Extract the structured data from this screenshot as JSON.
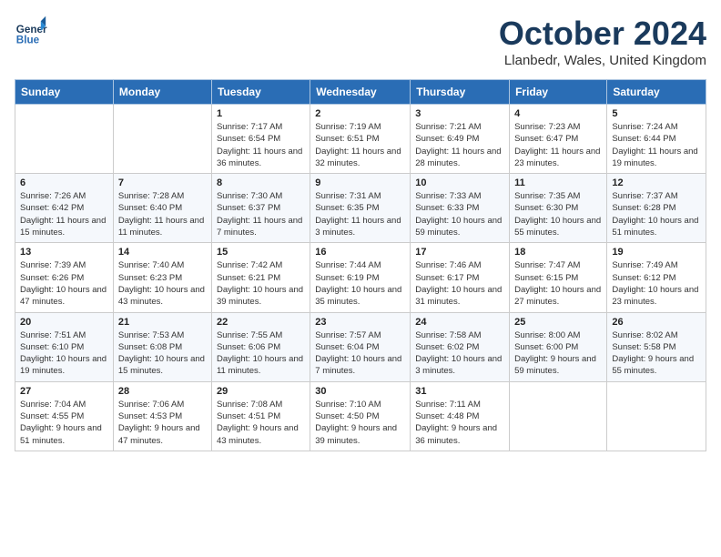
{
  "header": {
    "logo_line1": "General",
    "logo_line2": "Blue",
    "month": "October 2024",
    "location": "Llanbedr, Wales, United Kingdom"
  },
  "days_of_week": [
    "Sunday",
    "Monday",
    "Tuesday",
    "Wednesday",
    "Thursday",
    "Friday",
    "Saturday"
  ],
  "weeks": [
    [
      {
        "day": "",
        "info": ""
      },
      {
        "day": "",
        "info": ""
      },
      {
        "day": "1",
        "info": "Sunrise: 7:17 AM\nSunset: 6:54 PM\nDaylight: 11 hours and 36 minutes."
      },
      {
        "day": "2",
        "info": "Sunrise: 7:19 AM\nSunset: 6:51 PM\nDaylight: 11 hours and 32 minutes."
      },
      {
        "day": "3",
        "info": "Sunrise: 7:21 AM\nSunset: 6:49 PM\nDaylight: 11 hours and 28 minutes."
      },
      {
        "day": "4",
        "info": "Sunrise: 7:23 AM\nSunset: 6:47 PM\nDaylight: 11 hours and 23 minutes."
      },
      {
        "day": "5",
        "info": "Sunrise: 7:24 AM\nSunset: 6:44 PM\nDaylight: 11 hours and 19 minutes."
      }
    ],
    [
      {
        "day": "6",
        "info": "Sunrise: 7:26 AM\nSunset: 6:42 PM\nDaylight: 11 hours and 15 minutes."
      },
      {
        "day": "7",
        "info": "Sunrise: 7:28 AM\nSunset: 6:40 PM\nDaylight: 11 hours and 11 minutes."
      },
      {
        "day": "8",
        "info": "Sunrise: 7:30 AM\nSunset: 6:37 PM\nDaylight: 11 hours and 7 minutes."
      },
      {
        "day": "9",
        "info": "Sunrise: 7:31 AM\nSunset: 6:35 PM\nDaylight: 11 hours and 3 minutes."
      },
      {
        "day": "10",
        "info": "Sunrise: 7:33 AM\nSunset: 6:33 PM\nDaylight: 10 hours and 59 minutes."
      },
      {
        "day": "11",
        "info": "Sunrise: 7:35 AM\nSunset: 6:30 PM\nDaylight: 10 hours and 55 minutes."
      },
      {
        "day": "12",
        "info": "Sunrise: 7:37 AM\nSunset: 6:28 PM\nDaylight: 10 hours and 51 minutes."
      }
    ],
    [
      {
        "day": "13",
        "info": "Sunrise: 7:39 AM\nSunset: 6:26 PM\nDaylight: 10 hours and 47 minutes."
      },
      {
        "day": "14",
        "info": "Sunrise: 7:40 AM\nSunset: 6:23 PM\nDaylight: 10 hours and 43 minutes."
      },
      {
        "day": "15",
        "info": "Sunrise: 7:42 AM\nSunset: 6:21 PM\nDaylight: 10 hours and 39 minutes."
      },
      {
        "day": "16",
        "info": "Sunrise: 7:44 AM\nSunset: 6:19 PM\nDaylight: 10 hours and 35 minutes."
      },
      {
        "day": "17",
        "info": "Sunrise: 7:46 AM\nSunset: 6:17 PM\nDaylight: 10 hours and 31 minutes."
      },
      {
        "day": "18",
        "info": "Sunrise: 7:47 AM\nSunset: 6:15 PM\nDaylight: 10 hours and 27 minutes."
      },
      {
        "day": "19",
        "info": "Sunrise: 7:49 AM\nSunset: 6:12 PM\nDaylight: 10 hours and 23 minutes."
      }
    ],
    [
      {
        "day": "20",
        "info": "Sunrise: 7:51 AM\nSunset: 6:10 PM\nDaylight: 10 hours and 19 minutes."
      },
      {
        "day": "21",
        "info": "Sunrise: 7:53 AM\nSunset: 6:08 PM\nDaylight: 10 hours and 15 minutes."
      },
      {
        "day": "22",
        "info": "Sunrise: 7:55 AM\nSunset: 6:06 PM\nDaylight: 10 hours and 11 minutes."
      },
      {
        "day": "23",
        "info": "Sunrise: 7:57 AM\nSunset: 6:04 PM\nDaylight: 10 hours and 7 minutes."
      },
      {
        "day": "24",
        "info": "Sunrise: 7:58 AM\nSunset: 6:02 PM\nDaylight: 10 hours and 3 minutes."
      },
      {
        "day": "25",
        "info": "Sunrise: 8:00 AM\nSunset: 6:00 PM\nDaylight: 9 hours and 59 minutes."
      },
      {
        "day": "26",
        "info": "Sunrise: 8:02 AM\nSunset: 5:58 PM\nDaylight: 9 hours and 55 minutes."
      }
    ],
    [
      {
        "day": "27",
        "info": "Sunrise: 7:04 AM\nSunset: 4:55 PM\nDaylight: 9 hours and 51 minutes."
      },
      {
        "day": "28",
        "info": "Sunrise: 7:06 AM\nSunset: 4:53 PM\nDaylight: 9 hours and 47 minutes."
      },
      {
        "day": "29",
        "info": "Sunrise: 7:08 AM\nSunset: 4:51 PM\nDaylight: 9 hours and 43 minutes."
      },
      {
        "day": "30",
        "info": "Sunrise: 7:10 AM\nSunset: 4:50 PM\nDaylight: 9 hours and 39 minutes."
      },
      {
        "day": "31",
        "info": "Sunrise: 7:11 AM\nSunset: 4:48 PM\nDaylight: 9 hours and 36 minutes."
      },
      {
        "day": "",
        "info": ""
      },
      {
        "day": "",
        "info": ""
      }
    ]
  ]
}
